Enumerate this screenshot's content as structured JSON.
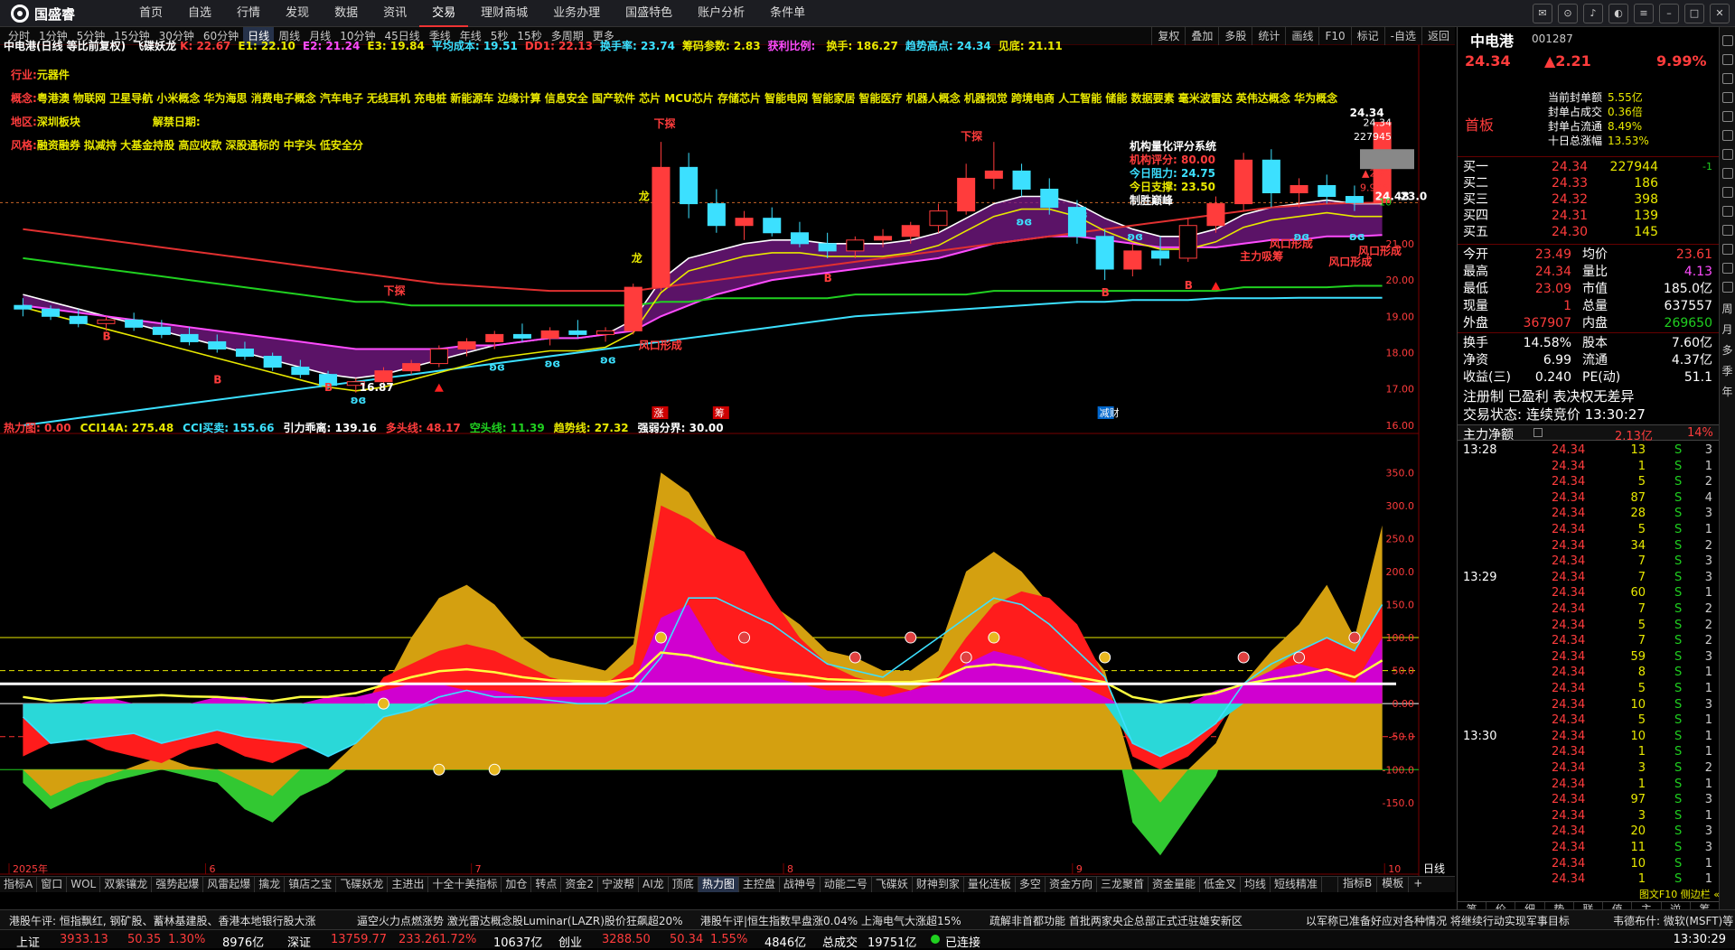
{
  "app": {
    "name": "国盛睿",
    "menu": [
      "首页",
      "自选",
      "行情",
      "发现",
      "数据",
      "资讯",
      "交易",
      "理财商城",
      "业务办理",
      "国盛特色",
      "账户分析",
      "条件单"
    ],
    "active_menu": "交易"
  },
  "periods": [
    "分时",
    "1分钟",
    "5分钟",
    "15分钟",
    "30分钟",
    "60分钟",
    "日线",
    "周线",
    "月线",
    "10分钟",
    "45日线",
    "季线",
    "年线",
    "5秒",
    "15秒",
    "多周期",
    "更多"
  ],
  "active_period": "日线",
  "right_tools": [
    "复权",
    "叠加",
    "多股",
    "统计",
    "画线",
    "F10",
    "标记",
    "-自选",
    "返回"
  ],
  "stock": {
    "name": "中电港",
    "code": "001287",
    "price": "24.34",
    "change": "▲2.21",
    "pct": "9.99%",
    "board": "首板"
  },
  "main_legend": {
    "title": "中电港(日线 等比前复权)",
    "items": [
      {
        "label": "飞碟妖龙",
        "val": "K: 22.67",
        "color": "#ff3c3c"
      },
      {
        "label": "",
        "val": "E1: 22.10",
        "color": "#e8e800"
      },
      {
        "label": "",
        "val": "E2: 21.24",
        "color": "#ff4cff"
      },
      {
        "label": "",
        "val": "E3: 19.84",
        "color": "#e8e800"
      },
      {
        "label": "",
        "val": "平均成本: 19.51",
        "color": "#3ce0ff"
      },
      {
        "label": "",
        "val": "DD1: 22.13",
        "color": "#ff3c3c"
      },
      {
        "label": "",
        "val": "换手率: 23.74",
        "color": "#3ce0ff"
      },
      {
        "label": "",
        "val": "筹码参数: 2.83",
        "color": "#e8e800"
      },
      {
        "label": "",
        "val": "获利比例: ",
        "color": "#ff4cff"
      },
      {
        "label": "",
        "val": "换手: 186.27",
        "color": "#e8e800"
      },
      {
        "label": "",
        "val": "趋势高点: 24.34",
        "color": "#3ce0ff"
      },
      {
        "label": "",
        "val": "见底: 21.11",
        "color": "#e8e800"
      }
    ]
  },
  "info_lines": {
    "industry_label": "行业:",
    "industry": "元器件",
    "concept_label": "概念:",
    "concept": "粤港澳 物联网 卫星导航 小米概念 华为海思 消费电子概念 汽车电子 无线耳机 充电桩 新能源车 边缘计算 信息安全 国产软件 芯片 MCU芯片 存储芯片 智能电网 智能家居 智能医疗 机器人概念 机器视觉 跨境电商 人工智能 储能 数据要素 毫米波雷达 英伟达概念 华为概念",
    "region_label": "地区:",
    "region": "深圳板块",
    "unlock_label": "解禁日期:",
    "style_label": "风格:",
    "style": "融资融券 拟减持 大基金持股 高应收款 深股通标的 中字头 低安全分"
  },
  "quant_box": {
    "title": "机构量化评分系统",
    "score": "机构评分: 80.00",
    "resist": "今日阻力: 24.75",
    "support": "今日支撑: 23.50",
    "strat": "制胜巅峰"
  },
  "chart_labels": {
    "xiadie": "下探",
    "dragon": "龙",
    "fengkou": "风口形成",
    "zhuli": "主力吸筹",
    "zhang": "涨",
    "chou": "筹",
    "jiancai": "减财"
  },
  "main_chart": {
    "type": "candlestick",
    "y_ticks": [
      "24.34",
      "227945",
      "24.34",
      "▲2.21",
      "9.99%",
      "10",
      "21.00",
      "20.00",
      "19.00",
      "18.00",
      "17.00",
      "16.00"
    ],
    "price_marks": {
      "high": "24.34",
      "last": "24.48",
      "last2": "23.0"
    },
    "low_mark": "16.87"
  },
  "chart_data": {
    "type": "candlestick",
    "title": "中电港(日线 等比前复权)",
    "x_ticks": [
      "2025年",
      "6",
      "7",
      "8",
      "9",
      "10"
    ],
    "y_axis": {
      "min": 16,
      "max": 24.34,
      "ticks": [
        16,
        17,
        18,
        19,
        20,
        21,
        22,
        23,
        24
      ]
    },
    "candles": [
      [
        19.3,
        19.5,
        19.0,
        19.2
      ],
      [
        19.2,
        19.3,
        18.9,
        19.0
      ],
      [
        19.0,
        19.2,
        18.7,
        18.8
      ],
      [
        18.8,
        19.0,
        18.6,
        18.9
      ],
      [
        18.9,
        19.1,
        18.6,
        18.7
      ],
      [
        18.7,
        18.9,
        18.4,
        18.5
      ],
      [
        18.5,
        18.7,
        18.2,
        18.3
      ],
      [
        18.3,
        18.5,
        18.0,
        18.1
      ],
      [
        18.1,
        18.3,
        17.8,
        17.9
      ],
      [
        17.9,
        18.0,
        17.5,
        17.6
      ],
      [
        17.6,
        17.8,
        17.3,
        17.4
      ],
      [
        17.4,
        17.5,
        17.0,
        17.1
      ],
      [
        17.1,
        17.3,
        16.9,
        17.2
      ],
      [
        17.2,
        17.6,
        17.1,
        17.5
      ],
      [
        17.5,
        17.8,
        17.4,
        17.7
      ],
      [
        17.7,
        18.2,
        17.6,
        18.1
      ],
      [
        18.1,
        18.4,
        17.9,
        18.3
      ],
      [
        18.3,
        18.6,
        18.1,
        18.5
      ],
      [
        18.5,
        18.8,
        18.3,
        18.4
      ],
      [
        18.4,
        18.7,
        18.2,
        18.6
      ],
      [
        18.6,
        18.9,
        18.4,
        18.5
      ],
      [
        18.5,
        18.7,
        18.3,
        18.6
      ],
      [
        18.6,
        19.9,
        18.5,
        19.8
      ],
      [
        19.8,
        23.8,
        19.7,
        23.1
      ],
      [
        23.1,
        23.5,
        21.7,
        22.1
      ],
      [
        22.1,
        22.5,
        21.3,
        21.5
      ],
      [
        21.5,
        21.9,
        21.1,
        21.7
      ],
      [
        21.7,
        22.0,
        21.2,
        21.3
      ],
      [
        21.3,
        21.6,
        20.9,
        21.0
      ],
      [
        21.0,
        21.3,
        20.6,
        20.8
      ],
      [
        20.8,
        21.2,
        20.6,
        21.1
      ],
      [
        21.1,
        21.4,
        20.9,
        21.2
      ],
      [
        21.2,
        21.6,
        21.0,
        21.5
      ],
      [
        21.5,
        22.1,
        21.3,
        21.9
      ],
      [
        21.9,
        23.2,
        21.8,
        22.8
      ],
      [
        22.8,
        23.8,
        22.5,
        23.0
      ],
      [
        23.0,
        23.2,
        22.3,
        22.5
      ],
      [
        22.5,
        22.8,
        21.8,
        22.0
      ],
      [
        22.0,
        22.2,
        21.0,
        21.2
      ],
      [
        21.2,
        21.4,
        20.0,
        20.3
      ],
      [
        20.3,
        21.0,
        20.1,
        20.8
      ],
      [
        20.8,
        21.2,
        20.4,
        20.6
      ],
      [
        20.6,
        21.7,
        20.5,
        21.5
      ],
      [
        21.5,
        22.3,
        21.3,
        22.1
      ],
      [
        22.1,
        23.5,
        21.9,
        23.3
      ],
      [
        23.3,
        23.6,
        22.0,
        22.4
      ],
      [
        22.4,
        22.8,
        22.0,
        22.6
      ],
      [
        22.6,
        22.9,
        22.1,
        22.3
      ],
      [
        22.3,
        22.6,
        21.9,
        22.13
      ],
      [
        22.13,
        24.34,
        22.1,
        24.34
      ]
    ],
    "series": [
      {
        "name": "E1",
        "values": [
          19.6,
          19.4,
          19.2,
          19.0,
          18.8,
          18.6,
          18.4,
          18.2,
          18.0,
          17.8,
          17.6,
          17.4,
          17.3,
          17.4,
          17.6,
          17.8,
          18.0,
          18.2,
          18.3,
          18.4,
          18.4,
          18.5,
          18.9,
          20.0,
          20.6,
          20.8,
          21.0,
          21.1,
          21.1,
          21.0,
          21.0,
          21.0,
          21.1,
          21.3,
          21.7,
          22.1,
          22.3,
          22.3,
          22.1,
          21.7,
          21.4,
          21.2,
          21.2,
          21.4,
          21.8,
          22.0,
          22.1,
          22.2,
          22.1,
          22.1
        ]
      },
      {
        "name": "E2",
        "values": [
          19.3,
          19.2,
          19.1,
          19.0,
          18.9,
          18.8,
          18.7,
          18.6,
          18.5,
          18.4,
          18.3,
          18.2,
          18.1,
          18.1,
          18.1,
          18.1,
          18.2,
          18.2,
          18.3,
          18.4,
          18.4,
          18.5,
          18.6,
          19.0,
          19.3,
          19.6,
          19.8,
          20.0,
          20.1,
          20.2,
          20.3,
          20.4,
          20.5,
          20.6,
          20.8,
          21.0,
          21.1,
          21.2,
          21.2,
          21.1,
          21.0,
          20.9,
          20.9,
          20.9,
          21.0,
          21.1,
          21.1,
          21.2,
          21.2,
          21.24
        ]
      },
      {
        "name": "E3",
        "values": [
          20.6,
          20.5,
          20.4,
          20.3,
          20.2,
          20.1,
          20.0,
          19.9,
          19.8,
          19.7,
          19.6,
          19.5,
          19.4,
          19.4,
          19.3,
          19.3,
          19.3,
          19.3,
          19.3,
          19.3,
          19.3,
          19.3,
          19.3,
          19.4,
          19.4,
          19.5,
          19.5,
          19.5,
          19.5,
          19.5,
          19.6,
          19.6,
          19.6,
          19.6,
          19.6,
          19.7,
          19.7,
          19.7,
          19.7,
          19.7,
          19.7,
          19.7,
          19.7,
          19.7,
          19.8,
          19.8,
          19.8,
          19.8,
          19.84,
          19.84
        ]
      },
      {
        "name": "平均成本",
        "values": [
          16.0,
          16.1,
          16.2,
          16.3,
          16.4,
          16.5,
          16.6,
          16.7,
          16.8,
          16.9,
          17.0,
          17.1,
          17.2,
          17.3,
          17.4,
          17.5,
          17.6,
          17.7,
          17.8,
          17.9,
          18.0,
          18.1,
          18.2,
          18.3,
          18.4,
          18.5,
          18.6,
          18.7,
          18.8,
          18.9,
          19.0,
          19.05,
          19.1,
          19.15,
          19.2,
          19.25,
          19.3,
          19.35,
          19.4,
          19.4,
          19.45,
          19.45,
          19.45,
          19.5,
          19.5,
          19.5,
          19.51,
          19.51,
          19.51,
          19.51
        ]
      },
      {
        "name": "DD1",
        "values": [
          21.4,
          21.3,
          21.2,
          21.1,
          21.0,
          20.9,
          20.8,
          20.7,
          20.6,
          20.5,
          20.4,
          20.3,
          20.2,
          20.1,
          20.0,
          19.9,
          19.85,
          19.8,
          19.75,
          19.7,
          19.7,
          19.7,
          19.7,
          19.8,
          19.9,
          20.0,
          20.1,
          20.2,
          20.3,
          20.4,
          20.5,
          20.6,
          20.7,
          20.8,
          20.9,
          21.0,
          21.1,
          21.2,
          21.3,
          21.4,
          21.5,
          21.6,
          21.7,
          21.8,
          21.9,
          22.0,
          22.05,
          22.1,
          22.12,
          22.13
        ]
      }
    ]
  },
  "heat_legend": {
    "items": [
      {
        "val": "热力图: 0.00",
        "color": "#ff3c3c"
      },
      {
        "val": "CCI14A: 275.48",
        "color": "#e8e800"
      },
      {
        "val": "CCI买卖: 155.66",
        "color": "#3ce0ff"
      },
      {
        "val": "引力乖离: 139.16",
        "color": "#ffffff"
      },
      {
        "val": "多头线: 48.17",
        "color": "#ff3c3c"
      },
      {
        "val": "空头线: 11.39",
        "color": "#20d020"
      },
      {
        "val": "趋势线: 27.32",
        "color": "#e8e800"
      },
      {
        "val": "强弱分界: 30.00",
        "color": "#ffffff"
      }
    ]
  },
  "heat_chart": {
    "y_ticks": [
      "350.0",
      "300.0",
      "250.0",
      "200.0",
      "150.0",
      "100.0",
      "50.0",
      "0.00",
      "-50.0",
      "-100.0",
      "-150.0"
    ]
  },
  "bottom_tabs": [
    "指标A",
    "窗口",
    "WOL",
    "双紫镶龙",
    "强势起爆",
    "风雷起爆",
    "擒龙",
    "镇店之宝",
    "飞碟妖龙",
    "主进出",
    "十全十美指标",
    "加仓",
    "转点",
    "资金2",
    "宁波帮",
    "AI龙",
    "顶底",
    "热力图",
    "主控盘",
    "战神号",
    "动能二号",
    "飞碟妖",
    "财神到家",
    "量化连板",
    "多空",
    "资金方向",
    "三龙聚首",
    "资金量能",
    "低金叉",
    "均线",
    "短线精准"
  ],
  "active_tab": "热力图",
  "bottom_right_tabs": [
    "指标B",
    "模板",
    "+"
  ],
  "period_label": "日线",
  "right_panel": {
    "seal": [
      {
        "k": "当前封单额",
        "v": "5.55亿"
      },
      {
        "k": "封单占成交",
        "v": "0.36倍"
      },
      {
        "k": "封单占流通",
        "v": "8.49%"
      },
      {
        "k": "十日总涨幅",
        "v": "13.53%"
      }
    ],
    "buy": [
      {
        "k": "买一",
        "p": "24.34",
        "v": "227944",
        "d": "-1"
      },
      {
        "k": "买二",
        "p": "24.33",
        "v": "186",
        "d": ""
      },
      {
        "k": "买三",
        "p": "24.32",
        "v": "398",
        "d": ""
      },
      {
        "k": "买四",
        "p": "24.31",
        "v": "139",
        "d": ""
      },
      {
        "k": "买五",
        "p": "24.30",
        "v": "145",
        "d": ""
      }
    ],
    "quote": [
      {
        "k1": "今开",
        "v1": "23.49",
        "k2": "均价",
        "v2": "23.61",
        "c2": "#ff3c3c"
      },
      {
        "k1": "最高",
        "v1": "24.34",
        "k2": "量比",
        "v2": "4.13",
        "c2": "#ff4cff"
      },
      {
        "k1": "最低",
        "v1": "23.09",
        "k2": "市值",
        "v2": "185.0亿",
        "c2": "#fff"
      },
      {
        "k1": "现量",
        "v1": "1",
        "k2": "总量",
        "v2": "637557",
        "c2": "#fff"
      },
      {
        "k1": "外盘",
        "v1": "367907",
        "k2": "内盘",
        "v2": "269650",
        "c2": "#20d020"
      }
    ],
    "fund": [
      {
        "k1": "换手",
        "v1": "14.58%",
        "k2": "股本",
        "v2": "7.60亿"
      },
      {
        "k1": "净资",
        "v1": "6.99",
        "k2": "流通",
        "v2": "4.37亿"
      },
      {
        "k1": "收益(三)",
        "v1": "0.240",
        "k2": "PE(动)",
        "v2": "51.1"
      }
    ],
    "reg": "注册制 已盈利 表决权无差异",
    "trade_state": "交易状态: 连续竞价 13:30:27",
    "net_label": "主力净额",
    "net_val": "2.13亿",
    "net_pct": "14%",
    "ticks": [
      [
        "13:28",
        "24.34",
        "13",
        "S",
        "3"
      ],
      [
        "",
        "24.34",
        "1",
        "S",
        "1"
      ],
      [
        "",
        "24.34",
        "5",
        "S",
        "2"
      ],
      [
        "",
        "24.34",
        "87",
        "S",
        "4"
      ],
      [
        "",
        "24.34",
        "28",
        "S",
        "3"
      ],
      [
        "",
        "24.34",
        "5",
        "S",
        "1"
      ],
      [
        "",
        "24.34",
        "34",
        "S",
        "2"
      ],
      [
        "",
        "24.34",
        "7",
        "S",
        "3"
      ],
      [
        "13:29",
        "24.34",
        "7",
        "S",
        "3"
      ],
      [
        "",
        "24.34",
        "60",
        "S",
        "1"
      ],
      [
        "",
        "24.34",
        "7",
        "S",
        "2"
      ],
      [
        "",
        "24.34",
        "5",
        "S",
        "2"
      ],
      [
        "",
        "24.34",
        "7",
        "S",
        "2"
      ],
      [
        "",
        "24.34",
        "59",
        "S",
        "3"
      ],
      [
        "",
        "24.34",
        "8",
        "S",
        "1"
      ],
      [
        "",
        "24.34",
        "5",
        "S",
        "1"
      ],
      [
        "",
        "24.34",
        "10",
        "S",
        "3"
      ],
      [
        "",
        "24.34",
        "5",
        "S",
        "1"
      ],
      [
        "13:30",
        "24.34",
        "10",
        "S",
        "1"
      ],
      [
        "",
        "24.34",
        "1",
        "S",
        "1"
      ],
      [
        "",
        "24.34",
        "3",
        "S",
        "2"
      ],
      [
        "",
        "24.34",
        "1",
        "S",
        "1"
      ],
      [
        "",
        "24.34",
        "97",
        "S",
        "3"
      ],
      [
        "",
        "24.34",
        "3",
        "S",
        "1"
      ],
      [
        "",
        "24.34",
        "20",
        "S",
        "3"
      ],
      [
        "",
        "24.34",
        "11",
        "S",
        "3"
      ],
      [
        "",
        "24.34",
        "10",
        "S",
        "1"
      ],
      [
        "",
        "24.34",
        "1",
        "S",
        "1"
      ]
    ],
    "bottom_tabs": [
      "笔",
      "价",
      "细",
      "势",
      "联",
      "值",
      "主",
      "逆",
      "筹"
    ],
    "side_label": "图文F10 侧边栏 «"
  },
  "vsidebar": [
    "周",
    "月",
    "多",
    "季",
    "年"
  ],
  "ticker": [
    "港股午评: 恒指飘红, 钢矿股、蓄林基建股、香港本地银行股大涨",
    "逼空火力点燃涨势 激光雷达概念股Luminar(LAZR)股价狂飙超20%",
    "港股午评|恒生指数早盘涨0.04% 上海电气大涨超15%",
    "疏解非首都功能 首批两家央企总部正式迁驻雄安新区",
    "以军称已准备好应对各种情况 将继续行动实现军事目标",
    "韦德布什: 微软(MSFT)等"
  ],
  "status": [
    {
      "k": "上证",
      "v": "3933.13",
      "c": "50.35",
      "p": "1.30%",
      "a": "8976亿"
    },
    {
      "k": "深证",
      "v": "13759.77",
      "c": "233.26",
      "p": "1.72%",
      "a": "10637亿"
    },
    {
      "k": "创业",
      "v": "3288.50",
      "c": "50.34",
      "p": "1.55%",
      "a": "4846亿"
    }
  ],
  "total_label": "总成交",
  "total_val": "19751亿",
  "conn": "已连接",
  "time": "13:30:29",
  "colors": {
    "up": "#ff3c3c",
    "down": "#3ce0ff",
    "bg": "#000000"
  }
}
